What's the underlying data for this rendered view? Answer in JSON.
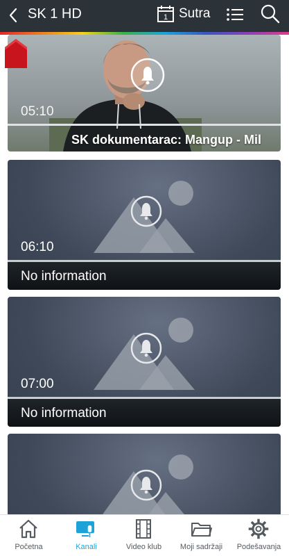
{
  "header": {
    "title": "SK 1 HD",
    "calendar_day": "1",
    "calendar_label": "Sutra"
  },
  "featured": {
    "time": "05:10",
    "caption": "SK dokumentarac: Mangup - Mil"
  },
  "programs": [
    {
      "time": "06:10",
      "title": "No information"
    },
    {
      "time": "07:00",
      "title": "No information"
    },
    {
      "time": "",
      "title": ""
    }
  ],
  "bottom_nav": {
    "items": [
      {
        "label": "Početna",
        "icon": "home-icon"
      },
      {
        "label": "Kanali",
        "icon": "channels-icon"
      },
      {
        "label": "Video klub",
        "icon": "film-icon"
      },
      {
        "label": "Moji sadržaji",
        "icon": "folder-icon"
      },
      {
        "label": "Podešavanja",
        "icon": "gear-icon"
      }
    ],
    "active_index": 1
  },
  "colors": {
    "header_bg": "#2b3238",
    "accent": "#1ea3d8",
    "home_badge": "#c8141c"
  }
}
